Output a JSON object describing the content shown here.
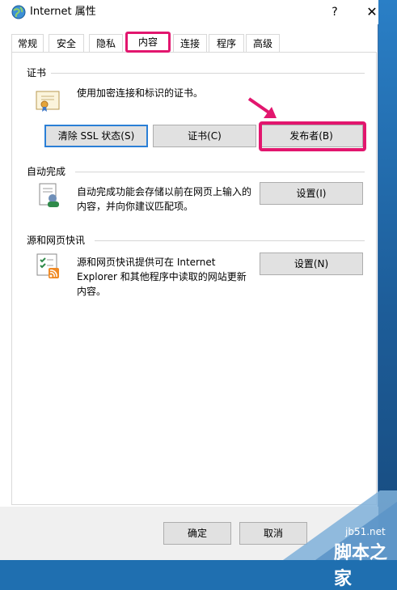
{
  "window": {
    "title": "Internet 属性",
    "help": "?",
    "close": "✕"
  },
  "tabs": [
    {
      "label": "常规"
    },
    {
      "label": "安全"
    },
    {
      "label": "隐私"
    },
    {
      "label": "内容",
      "active": true
    },
    {
      "label": "连接"
    },
    {
      "label": "程序"
    },
    {
      "label": "高级"
    }
  ],
  "certificates": {
    "group_title": "证书",
    "description": "使用加密连接和标识的证书。",
    "buttons": {
      "clear_ssl": "清除 SSL 状态(S)",
      "certificates": "证书(C)",
      "publishers": "发布者(B)"
    }
  },
  "autocomplete": {
    "group_title": "自动完成",
    "description_line1": "自动完成功能会存储以前在网页上输入的",
    "description_line2": "内容，并向你建议匹配项。",
    "settings_button": "设置(I)"
  },
  "feeds": {
    "group_title": "源和网页快讯",
    "description_line1": "源和网页快讯提供可在 Internet",
    "description_line2": "Explorer 和其他程序中读取的网站更新",
    "description_line3": "内容。",
    "settings_button": "设置(N)"
  },
  "footer": {
    "ok": "确定",
    "cancel": "取消"
  },
  "watermark": {
    "url": "jb51.net",
    "name": "脚本之家"
  },
  "colors": {
    "highlight": "#e2166e",
    "focus_border": "#2b7fd6",
    "button_face": "#e1e1e1"
  }
}
